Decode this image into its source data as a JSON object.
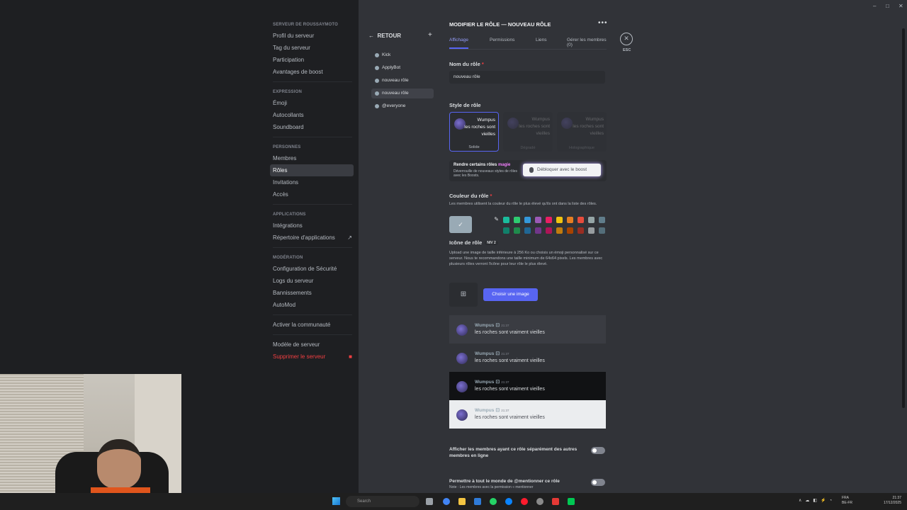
{
  "sidebar": {
    "sections": [
      {
        "heading": "SERVEUR DE ROUSSAYMOTO",
        "items": [
          "Profil du serveur",
          "Tag du serveur",
          "Participation",
          "Avantages de boost"
        ]
      },
      {
        "heading": "EXPRESSION",
        "items": [
          "Émoji",
          "Autocollants",
          "Soundboard"
        ]
      },
      {
        "heading": "PERSONNES",
        "items": [
          "Membres",
          "Rôles",
          "Invitations",
          "Accès"
        ]
      },
      {
        "heading": "APPLICATIONS",
        "items": [
          "Intégrations",
          "Répertoire d'applications"
        ]
      },
      {
        "heading": "MODÉRATION",
        "items": [
          "Configuration de Sécurité",
          "Logs du serveur",
          "Bannissements",
          "AutoMod"
        ]
      }
    ],
    "activate_community": "Activer la communauté",
    "server_template": "Modèle de serveur",
    "delete_server": "Supprimer le serveur"
  },
  "roles": {
    "back_label": "RETOUR",
    "items": [
      "Kick",
      "ApplyBot",
      "nouveau rôle",
      "nouveau rôle",
      "@everyone"
    ]
  },
  "editor": {
    "title": "MODIFIER LE RÔLE — NOUVEAU RÔLE",
    "tabs": [
      "Affichage",
      "Permissions",
      "Liens",
      "Gérer les membres (0)"
    ],
    "esc_label": "ESC",
    "name_label": "Nom du rôle",
    "name_value": "nouveau rôle",
    "style_label": "Style de rôle",
    "style_cards": [
      {
        "name": "Wumpus",
        "text": "les roches sont vieilles",
        "caption": "Solide"
      },
      {
        "name": "Wumpus",
        "text": "les roches sont vieilles",
        "caption": "Dégradé"
      },
      {
        "name": "Wumpus",
        "text": "les roches sont vieilles",
        "caption": "Holographique"
      }
    ],
    "boost": {
      "title_prefix": "Rendre certains rôles",
      "title_magic": "magie",
      "desc": "Déverrouille de nouveaux styles de rôles avec les Boosts.",
      "button": "Débloquer avec le boost"
    },
    "color_label": "Couleur du rôle",
    "color_desc": "Les membres utilisent la couleur du rôle le plus élevé qu'ils ont dans la liste des rôles.",
    "swatches_top": [
      "#1abc9c",
      "#2ecc71",
      "#3498db",
      "#9b59b6",
      "#e91e63",
      "#f1c40f",
      "#e67e22",
      "#e74c3c",
      "#95a5a6",
      "#607d8b"
    ],
    "swatches_bottom": [
      "#11806a",
      "#1f8b4c",
      "#206694",
      "#71368a",
      "#ad1457",
      "#c27c0e",
      "#a84300",
      "#992d22",
      "#979c9f",
      "#546e7a"
    ],
    "icon_label": "Icône de rôle",
    "icon_badge": "NIV 2",
    "icon_desc": "Upload une image de taille inférieure à 256 Ko ou choisis un émoji personnalisé sur ce serveur. Nous te recommandons une taille minimum de 64x64 pixels. Les membres avec plusieurs rôles verront l'icône pour leur rôle le plus élevé.",
    "choose_image": "Choisir une image",
    "previews": [
      {
        "name": "Wumpus",
        "time": "21:37",
        "text": "les roches sont vraiment vieilles",
        "bg": "#3a3c42"
      },
      {
        "name": "Wumpus",
        "time": "21:37",
        "text": "les roches sont vraiment vieilles",
        "bg": "#313338"
      },
      {
        "name": "Wumpus",
        "time": "21:37",
        "text": "les roches sont vraiment vieilles",
        "bg": "#111214"
      },
      {
        "name": "Wumpus",
        "time": "21:37",
        "text": "les roches sont vraiment vieilles",
        "bg": "#ebedef"
      }
    ],
    "toggle1": "Afficher les membres ayant ce rôle séparément des autres membres en ligne",
    "toggle2": "Permettre à tout le monde de @mentionner ce rôle",
    "toggle2_note": "Note : Les membres avec la permission « mentionner"
  },
  "taskbar": {
    "search_placeholder": "Search",
    "lang_line1": "FRA",
    "lang_line2": "BE-FR",
    "time": "21:37",
    "date": "17/12/2025"
  }
}
